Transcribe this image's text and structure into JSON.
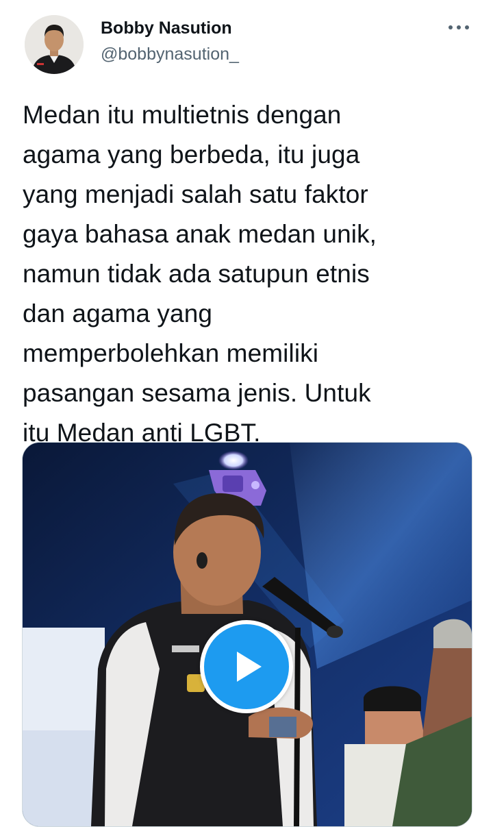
{
  "author": {
    "display_name": "Bobby Nasution",
    "handle": "@bobbynasution_"
  },
  "tweet": {
    "text": "Medan itu multietnis dengan\nagama yang berbeda, itu juga\nyang menjadi salah satu faktor\ngaya bahasa anak medan unik,\nnamun tidak ada satupun etnis\ndan agama yang\nmemperbolehkan memiliki\npasangan sesama jenis. Untuk\nitu Medan anti LGBT."
  },
  "icons": {
    "more": "more-horizontal-icon",
    "play": "play-icon"
  },
  "colors": {
    "accent": "#1d9bf0",
    "text_primary": "#0f1419",
    "text_secondary": "#536471",
    "border": "#cfd9de"
  }
}
